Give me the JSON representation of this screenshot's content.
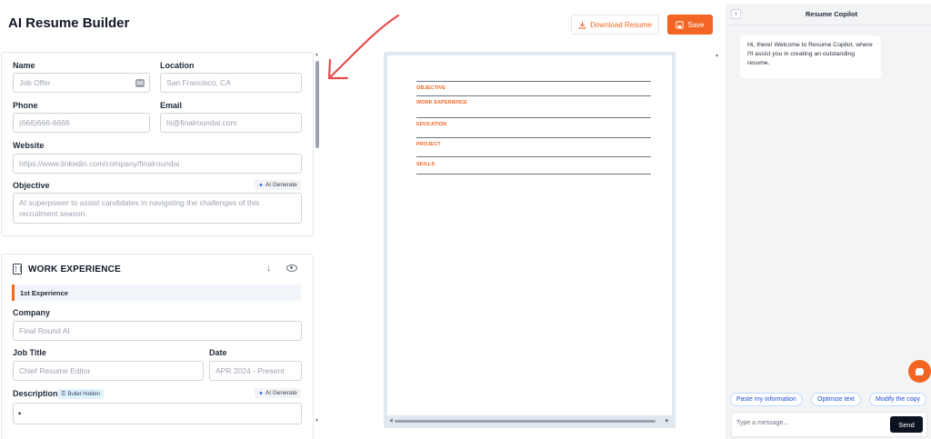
{
  "header": {
    "title": "AI Resume Builder",
    "download_label": "Download Resume",
    "save_label": "Save"
  },
  "form": {
    "name_label": "Name",
    "name_value": "Job Offer",
    "location_label": "Location",
    "location_value": "San Francisco, CA",
    "phone_label": "Phone",
    "phone_value": "(666)666-6666",
    "email_label": "Email",
    "email_value": "hi@finalroundai.com",
    "website_label": "Website",
    "website_value": "https://www.linkedin.com/company/finalroundai",
    "objective_label": "Objective",
    "ai_generate_label": "AI Generate",
    "objective_value": "AI superpower to assist candidates in navigating the challenges of this recruitment season."
  },
  "work": {
    "section_title": "WORK EXPERIENCE",
    "experience_tab": "1st Experience",
    "company_label": "Company",
    "company_value": "Final Round AI",
    "job_title_label": "Job Title",
    "job_title_value": "Chief Resume Editor",
    "date_label": "Date",
    "date_value": "APR 2024 - Present",
    "description_label": "Description",
    "bullet_hidden_label": "Bullet Hidden",
    "ai_generate_label": "AI Generate",
    "bullet": "•"
  },
  "preview": {
    "sections": [
      "OBJECTIVE",
      "WORK EXPERIENCE",
      "EDUCATION",
      "PROJECT",
      "SKILLS"
    ]
  },
  "copilot": {
    "title": "Resume Copilot",
    "welcome": "Hi, there! Welcome to Resume Copilot, where I'll assist you in creating an outstanding resume.",
    "chips": [
      "Paste my information",
      "Optimize text",
      "Modify the copy"
    ],
    "input_placeholder": "Type a message...",
    "send_label": "Send"
  },
  "colors": {
    "accent": "#f26522",
    "annotation_arrow": "#e74c4c"
  }
}
